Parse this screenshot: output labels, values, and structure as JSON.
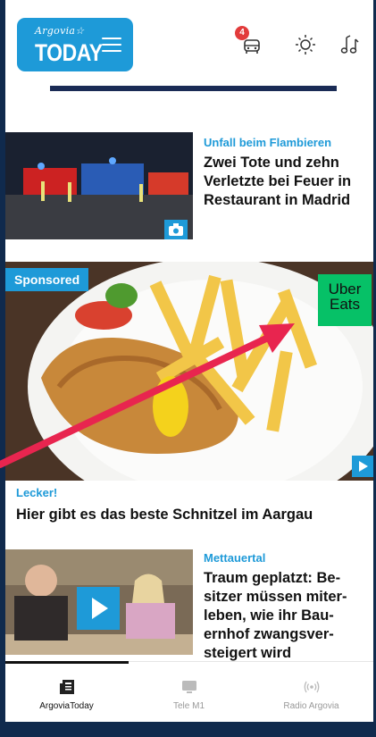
{
  "header": {
    "logo_script": "Argovia☆",
    "logo_word": "TODAY",
    "notification_count": "4"
  },
  "articles": [
    {
      "kicker": "Unfall beim Flambieren",
      "headline_lines": [
        "Zwei Tote und zehn",
        "Verletzte bei Feuer in",
        "Restaurant in Madrid"
      ]
    },
    {
      "sponsored_label": "Sponsored",
      "advertiser_lines": [
        "Uber",
        "Eats"
      ],
      "kicker": "Lecker!",
      "headline": "Hier gibt es das beste Schnitzel im Aargau"
    },
    {
      "kicker": "Mettauertal",
      "headline_lines": [
        "Traum geplatzt: Be-",
        "sitzer müssen miter-",
        "leben, wie ihr Bau-",
        "ernhof zwangsver-",
        "steigert wird"
      ]
    }
  ],
  "tabbar": {
    "tabs": [
      {
        "label": "ArgoviaToday",
        "active": true
      },
      {
        "label": "Tele M1",
        "active": false
      },
      {
        "label": "Radio Argovia",
        "active": false
      }
    ]
  },
  "colors": {
    "accent": "#1e9ad8",
    "frame": "#102a4d",
    "annotation_arrow": "#e8254f",
    "uber_green": "#06c167"
  }
}
